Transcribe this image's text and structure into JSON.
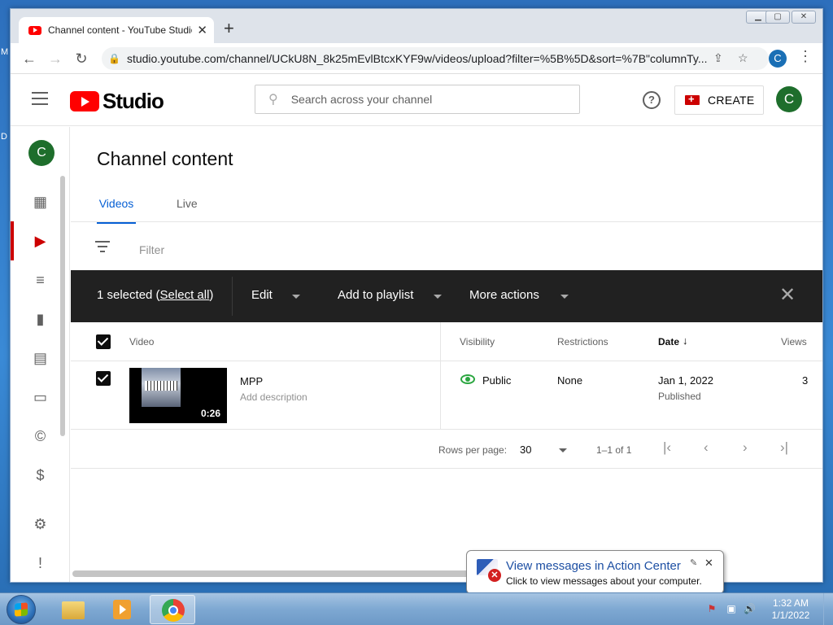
{
  "browser": {
    "tab_title": "Channel content - YouTube Studio",
    "url": "studio.youtube.com/channel/UCkU8N_8k25mEvlBtcxKYF9w/videos/upload?filter=%5B%5D&sort=%7B\"columnTy...",
    "profile_initial": "C"
  },
  "header": {
    "brand": "Studio",
    "search_placeholder": "Search across your channel",
    "create_label": "CREATE",
    "avatar_initial": "C"
  },
  "nav": {
    "avatar_initial": "C",
    "items": [
      "dashboard-icon",
      "content-icon",
      "playlists-icon",
      "analytics-icon",
      "comments-icon",
      "subtitles-icon",
      "copyright-icon",
      "earn-icon",
      "settings-icon",
      "feedback-icon"
    ]
  },
  "main": {
    "title": "Channel content",
    "tabs": [
      {
        "label": "Videos"
      },
      {
        "label": "Live"
      }
    ],
    "filter_placeholder": "Filter",
    "actionbar": {
      "selected": "1 selected (",
      "select_all": "Select all",
      "selected_suffix": ")",
      "edit": "Edit",
      "add_to_playlist": "Add to playlist",
      "more_actions": "More actions"
    },
    "columns": {
      "video": "Video",
      "visibility": "Visibility",
      "restrictions": "Restrictions",
      "date": "Date",
      "views": "Views"
    },
    "rows": [
      {
        "title": "MPP",
        "description": "Add description",
        "duration": "0:26",
        "visibility": "Public",
        "restrictions": "None",
        "date": "Jan 1, 2022",
        "date_status": "Published",
        "views": "3"
      }
    ],
    "pager": {
      "rows_label": "Rows per page:",
      "rows_value": "30",
      "range": "1–1 of 1"
    }
  },
  "balloon": {
    "title": "View messages in Action Center",
    "text": "Click to view messages about your computer."
  },
  "taskbar": {
    "time": "1:32 AM",
    "date": "1/1/2022"
  },
  "colors": {
    "accent": "#065fd4",
    "youtube_red": "#ff0000",
    "public_green": "#2ba640",
    "action_bar": "#212121"
  }
}
